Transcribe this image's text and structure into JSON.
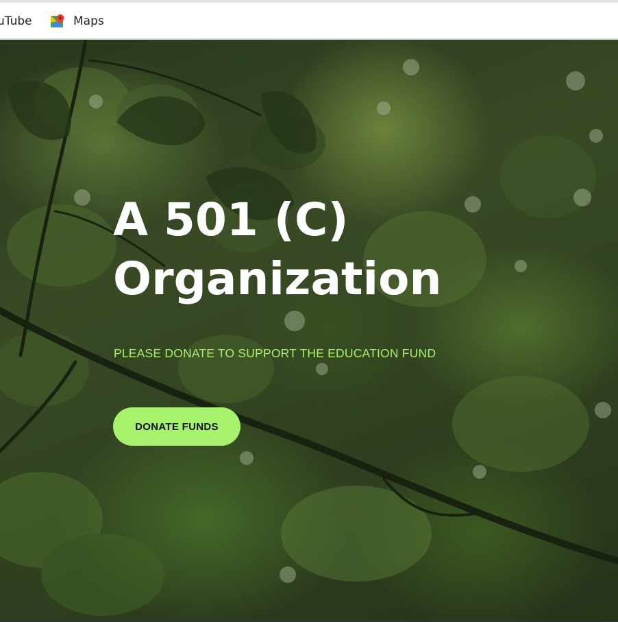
{
  "bookmarks": [
    {
      "label": "uTube",
      "icon": "youtube-icon"
    },
    {
      "label": "Maps",
      "icon": "google-maps-icon"
    }
  ],
  "hero": {
    "title_line1": "A 501 (C)",
    "title_line2": "Organization",
    "subtitle": "PLEASE DONATE TO SUPPORT THE EDUCATION FUND",
    "button_label": "DONATE FUNDS"
  },
  "colors": {
    "accent": "#a6f26d",
    "title": "#ffffff",
    "button_text": "#101010"
  }
}
